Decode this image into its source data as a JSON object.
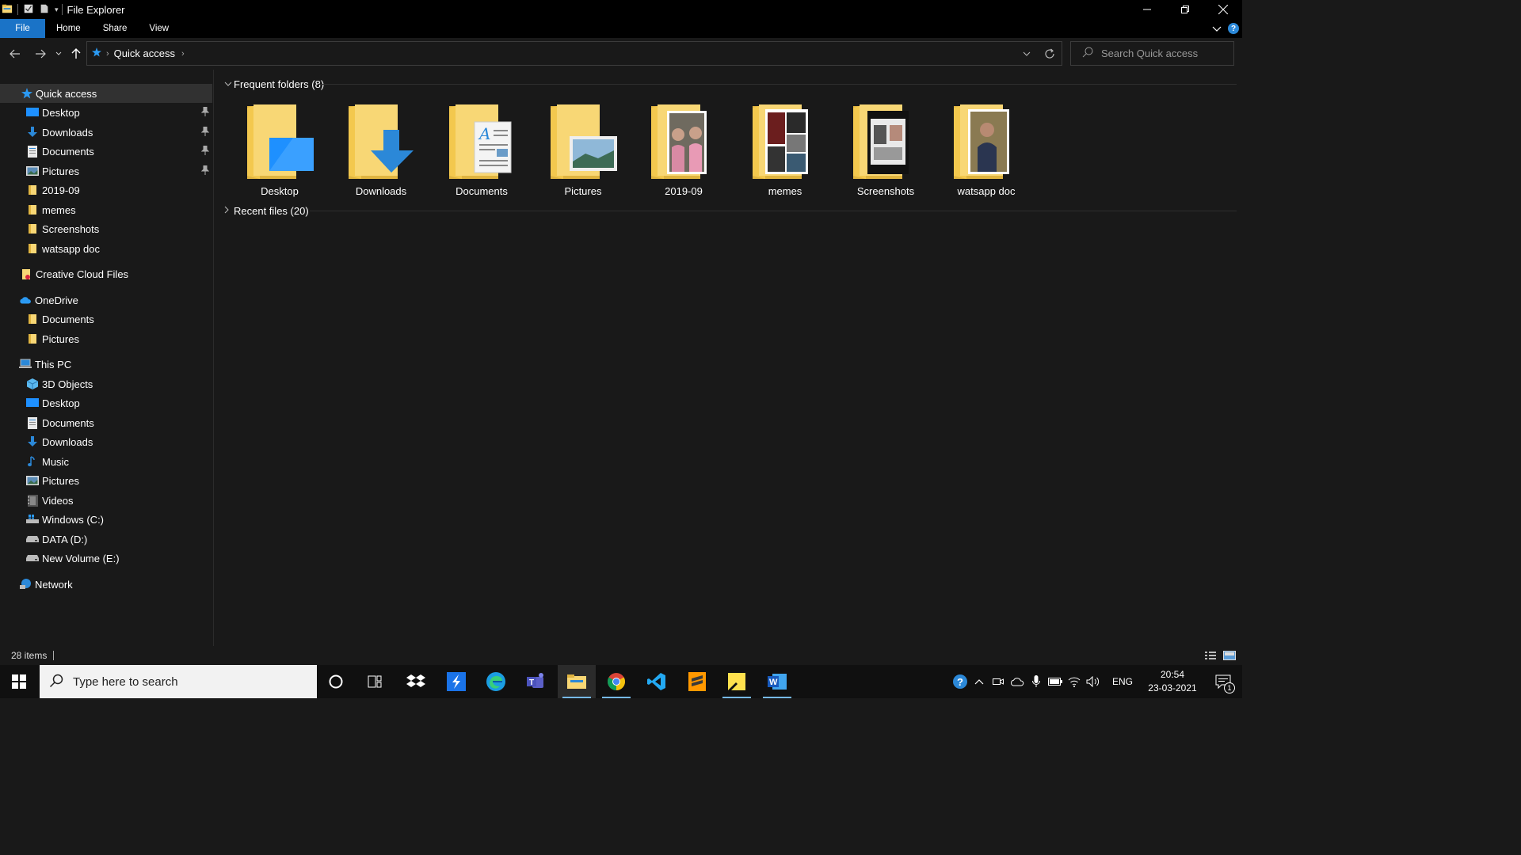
{
  "window": {
    "title": "File Explorer"
  },
  "ribbon": {
    "tabs": [
      "File",
      "Home",
      "Share",
      "View"
    ]
  },
  "address": {
    "location": "Quick access",
    "search_placeholder": "Search Quick access"
  },
  "navpane": {
    "quick_access": "Quick access",
    "quick_items": [
      {
        "label": "Desktop",
        "icon": "desktop-icon",
        "pinned": true
      },
      {
        "label": "Downloads",
        "icon": "downloads-icon",
        "pinned": true
      },
      {
        "label": "Documents",
        "icon": "documents-icon",
        "pinned": true
      },
      {
        "label": "Pictures",
        "icon": "pictures-icon",
        "pinned": true
      },
      {
        "label": "2019-09",
        "icon": "folder-icon",
        "pinned": false
      },
      {
        "label": "memes",
        "icon": "folder-icon",
        "pinned": false
      },
      {
        "label": "Screenshots",
        "icon": "folder-icon",
        "pinned": false
      },
      {
        "label": "watsapp doc",
        "icon": "folder-icon",
        "pinned": false
      }
    ],
    "creative_cloud": "Creative Cloud Files",
    "onedrive": "OneDrive",
    "onedrive_items": [
      "Documents",
      "Pictures"
    ],
    "this_pc": "This PC",
    "pc_items": [
      {
        "label": "3D Objects",
        "icon": "3d-objects-icon"
      },
      {
        "label": "Desktop",
        "icon": "desktop-icon"
      },
      {
        "label": "Documents",
        "icon": "documents-icon"
      },
      {
        "label": "Downloads",
        "icon": "downloads-icon"
      },
      {
        "label": "Music",
        "icon": "music-icon"
      },
      {
        "label": "Pictures",
        "icon": "pictures-icon"
      },
      {
        "label": "Videos",
        "icon": "videos-icon"
      },
      {
        "label": "Windows (C:)",
        "icon": "windows-drive-icon"
      },
      {
        "label": "DATA (D:)",
        "icon": "drive-icon"
      },
      {
        "label": "New Volume (E:)",
        "icon": "drive-icon"
      }
    ],
    "network": "Network"
  },
  "content": {
    "frequent_header": "Frequent folders (8)",
    "recent_header": "Recent files (20)",
    "folders": [
      {
        "label": "Desktop",
        "overlay": "desktop"
      },
      {
        "label": "Downloads",
        "overlay": "downloads"
      },
      {
        "label": "Documents",
        "overlay": "documents"
      },
      {
        "label": "Pictures",
        "overlay": "pictures"
      },
      {
        "label": "2019-09",
        "overlay": "photo"
      },
      {
        "label": "memes",
        "overlay": "photo"
      },
      {
        "label": "Screenshots",
        "overlay": "photo"
      },
      {
        "label": "watsapp doc",
        "overlay": "photo"
      }
    ]
  },
  "status": {
    "items": "28 items"
  },
  "taskbar": {
    "search_placeholder": "Type here to search",
    "lang": "ENG",
    "time": "20:54",
    "date": "23-03-2021",
    "notification_count": "1",
    "apps": [
      "cortana",
      "task-view",
      "dropbox",
      "app-s",
      "edge",
      "teams",
      "file-explorer",
      "chrome",
      "vscode",
      "sublime",
      "sticky-notes",
      "word"
    ]
  },
  "colors": {
    "accent": "#1a73c7",
    "folder": "#f8d775",
    "folder_dark": "#e0b440",
    "bg": "#191919"
  }
}
